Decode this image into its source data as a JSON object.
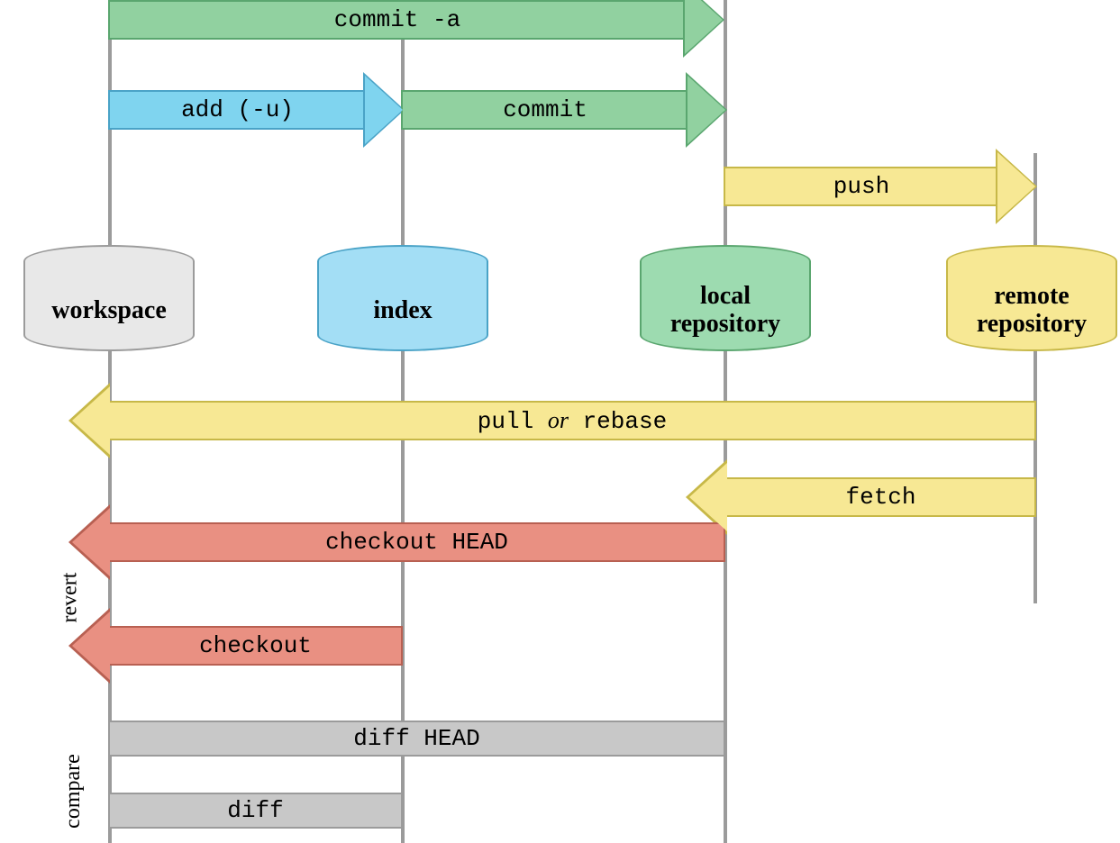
{
  "nodes": {
    "workspace": "workspace",
    "index": "index",
    "local": "local repository",
    "remote": "remote repository"
  },
  "arrows": {
    "commit_a": "commit -a",
    "add_u": "add (-u)",
    "commit": "commit",
    "push": "push",
    "pull_or_rebase_pre": "pull",
    "pull_or_rebase_mid": "or",
    "pull_or_rebase_post": "rebase",
    "fetch": "fetch",
    "checkout_head": "checkout HEAD",
    "checkout": "checkout"
  },
  "bars": {
    "diff_head": "diff HEAD",
    "diff": "diff"
  },
  "side_labels": {
    "revert": "revert",
    "compare": "compare"
  }
}
